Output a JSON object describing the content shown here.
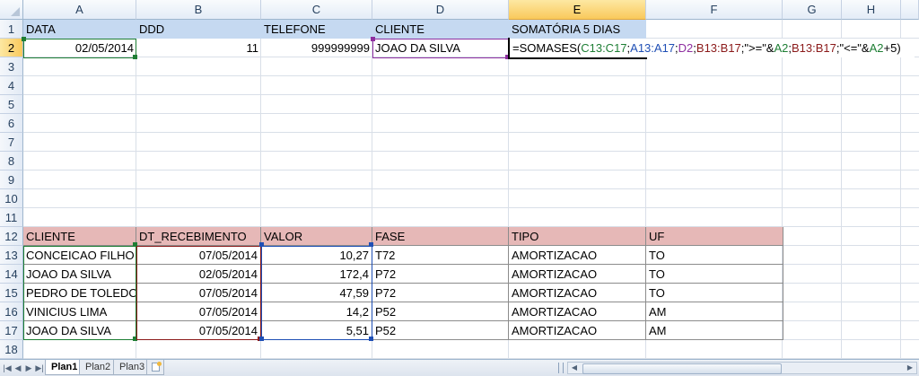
{
  "columns": [
    "A",
    "B",
    "C",
    "D",
    "E",
    "F",
    "G",
    "H"
  ],
  "rows": [
    "1",
    "2",
    "3",
    "4",
    "5",
    "6",
    "7",
    "8",
    "9",
    "10",
    "11",
    "12",
    "13",
    "14",
    "15",
    "16",
    "17",
    "18"
  ],
  "header_row1": [
    "DATA",
    "DDD",
    "TELEFONE",
    "CLIENTE",
    "SOMATÓRIA 5 DIAS"
  ],
  "row2": {
    "data": "02/05/2014",
    "ddd": "11",
    "telefone": "999999999",
    "cliente": "JOAO DA SILVA",
    "formula": {
      "p1": "=SOMASES(",
      "r1": "C13:C17",
      "p2": ";",
      "r2": "A13:A17",
      "p3": ";",
      "r3": "D2",
      "p4": ";",
      "r4": "B13:B17",
      "p5": ";\">=\"&",
      "r5": "A2",
      "p6": ";",
      "r6": "B13:B17",
      "p7": ";\"<=\"&",
      "r7": "A2",
      "p8": "+5)"
    }
  },
  "table_headers": [
    "CLIENTE",
    "DT_RECEBIMENTO",
    "VALOR",
    "FASE",
    "TIPO",
    "UF"
  ],
  "table_rows": [
    [
      "CONCEICAO FILHO",
      "07/05/2014",
      "10,27",
      "T72",
      "AMORTIZACAO",
      "TO"
    ],
    [
      "JOAO DA SILVA",
      "02/05/2014",
      "172,4",
      "P72",
      "AMORTIZACAO",
      "TO"
    ],
    [
      "PEDRO DE TOLEDO",
      "07/05/2014",
      "47,59",
      "P72",
      "AMORTIZACAO",
      "TO"
    ],
    [
      "VINICIUS LIMA",
      "07/05/2014",
      "14,2",
      "P52",
      "AMORTIZACAO",
      "AM"
    ],
    [
      "JOAO DA SILVA",
      "07/05/2014",
      "5,51",
      "P52",
      "AMORTIZACAO",
      "AM"
    ]
  ],
  "sheet_tabs": [
    "Plan1",
    "Plan2",
    "Plan3"
  ],
  "active_sheet": "Plan1",
  "active_cell": "E2",
  "colors": {
    "header_blue": "#c5d9f1",
    "header_red": "#e6b8b7",
    "ref_green": "#1e7e34",
    "ref_blue": "#1f4fb5",
    "ref_purple": "#8e2fa0",
    "ref_darkred": "#8b1a1a"
  }
}
